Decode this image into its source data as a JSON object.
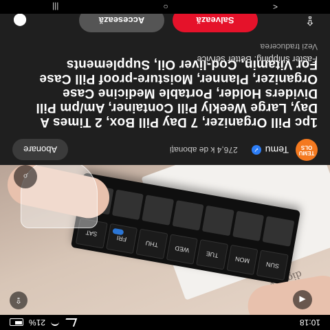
{
  "status_bar": {
    "time": "10:18",
    "battery": "21%",
    "indicators": [
      "signal-icon",
      "wifi-icon",
      "battery-icon"
    ]
  },
  "photo": {
    "paper_heading": "dignity",
    "pill_labels": [
      "SUN",
      "MON",
      "TUE",
      "WED",
      "THU",
      "FRI",
      "SAT"
    ],
    "controls": [
      "visual-search-icon",
      "share-icon",
      "back-arrow-icon"
    ]
  },
  "seller": {
    "logo_text_1": "TEMU",
    "logo_text_2": "OLS",
    "name": "Temu",
    "followers": "276,4 k de abonați",
    "follow_label": "Abonare",
    "verified_icon": "verified-check-icon"
  },
  "product": {
    "title": "1pc Pill Organizer, 7 Day Pill Box, 2 Times A Day, Large Weekly Pill Container, Am/pm Pill Dividers Holder, Portable Medicine Case Organizer, Planner, Moisture-proof Pill Case For Vitamin, Cod-liver Oil, Supplements",
    "subtitle": "Faster shipping. Better service",
    "translate_link": "Vezi traducerea"
  },
  "actions": {
    "save_label": "Salvează",
    "access_label": "Accesează",
    "share_icon": "share-icon",
    "pin_icon": "pin-icon"
  },
  "nav_bar": {
    "back": "<",
    "home": "○",
    "recents": "|||"
  },
  "colors": {
    "background": "#1f1f1f",
    "save_button": "#e5122a",
    "access_button": "#555555",
    "temu_orange": "#f4791f",
    "verified_blue": "#2d7ef7"
  }
}
